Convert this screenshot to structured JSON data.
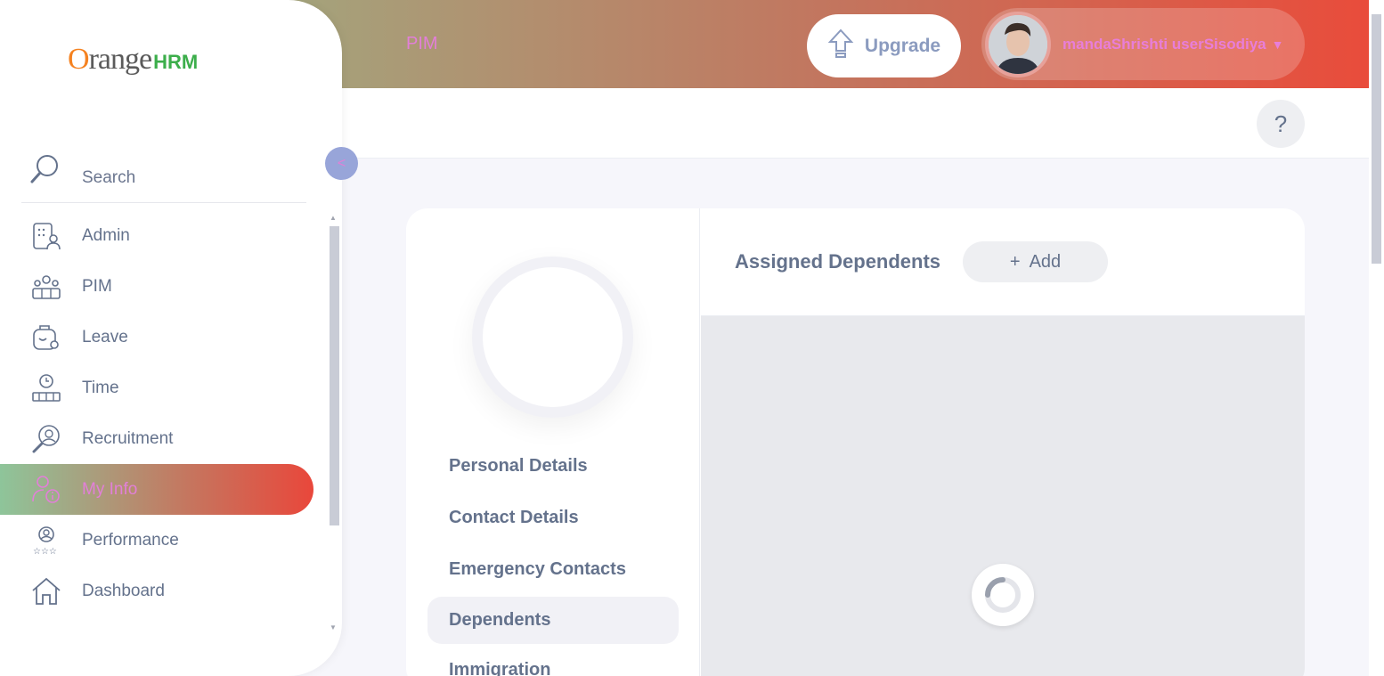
{
  "header": {
    "module_title": "PIM",
    "upgrade_label": "Upgrade",
    "user_name": "mandaShrishti userSisodiya",
    "help_label": "?"
  },
  "sidebar": {
    "logo_orange": "range",
    "logo_o": "O",
    "logo_hrm": "HRM",
    "search_label": "Search",
    "collapse_label": "<",
    "items": [
      {
        "label": "Admin",
        "icon": "admin-icon"
      },
      {
        "label": "PIM",
        "icon": "pim-icon"
      },
      {
        "label": "Leave",
        "icon": "leave-icon"
      },
      {
        "label": "Time",
        "icon": "time-icon"
      },
      {
        "label": "Recruitment",
        "icon": "recruitment-icon"
      },
      {
        "label": "My Info",
        "icon": "my-info-icon",
        "active": true
      },
      {
        "label": "Performance",
        "icon": "performance-icon"
      },
      {
        "label": "Dashboard",
        "icon": "dashboard-icon"
      }
    ]
  },
  "profile": {
    "tabs": [
      {
        "label": "Personal Details"
      },
      {
        "label": "Contact Details"
      },
      {
        "label": "Emergency Contacts"
      },
      {
        "label": "Dependents",
        "active": true
      },
      {
        "label": "Immigration"
      }
    ]
  },
  "dependents": {
    "title": "Assigned Dependents",
    "add_label": "Add",
    "add_icon": "+"
  },
  "colors": {
    "accent_pink": "#e27fd8",
    "header_start": "#8fbf8c",
    "header_end": "#e94c3b",
    "text": "#64728c"
  }
}
